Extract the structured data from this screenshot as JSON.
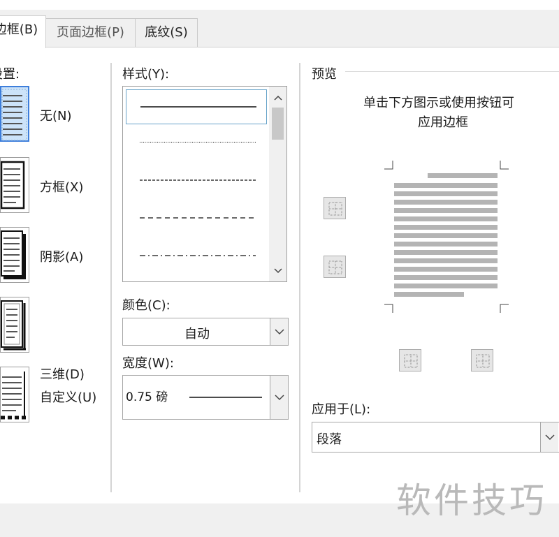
{
  "tabs": [
    {
      "label": "边框(B)",
      "mnemonic": "B",
      "active": true
    },
    {
      "label": "页面边框(P)",
      "mnemonic": "P",
      "active": false
    },
    {
      "label": "底纹(S)",
      "mnemonic": "S",
      "active": false
    }
  ],
  "setting": {
    "title": "设置:",
    "options": [
      {
        "label": "无(N)",
        "selected": true
      },
      {
        "label": "方框(X)",
        "selected": false
      },
      {
        "label": "阴影(A)",
        "selected": false
      },
      {
        "label": "三维(D)",
        "selected": false
      },
      {
        "label": "自定义(U)",
        "selected": false
      }
    ]
  },
  "style": {
    "title": "样式(Y):",
    "items": [
      "solid",
      "dotted",
      "dashed-small",
      "dashed-large",
      "dash-dot"
    ],
    "selected_index": 0
  },
  "color": {
    "title": "颜色(C):",
    "value": "自动"
  },
  "width": {
    "title": "宽度(W):",
    "value": "0.75 磅"
  },
  "preview": {
    "title": "预览",
    "hint_line1": "单击下方图示或使用按钮可",
    "hint_line2": "应用边框"
  },
  "apply_to": {
    "title": "应用于(L):",
    "value": "段落"
  },
  "watermark": "软件技巧",
  "colors": {
    "selection_border": "#3d7edb",
    "selection_fill": "#cce3f9"
  }
}
